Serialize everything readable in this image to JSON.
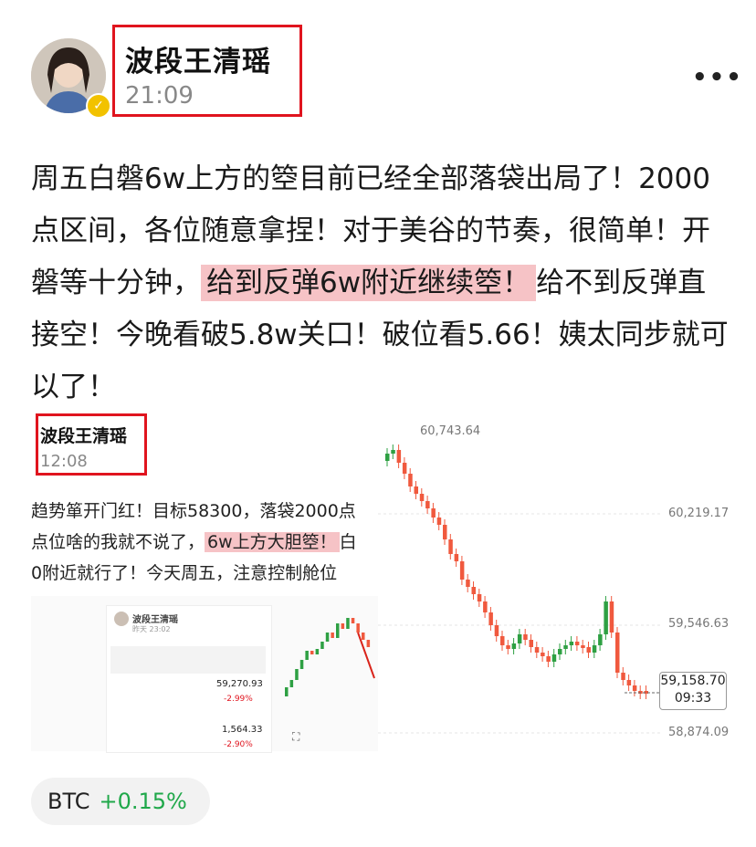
{
  "author": {
    "name": "波段王清瑶",
    "time": "21:09"
  },
  "post": {
    "text_before": "周五白磐6w上方的箜目前已经全部落袋出局了！2000点区间，各位随意拿捏！对于美谷的节奏，很简单！开磐等十分钟，",
    "highlight": "给到反弹6w附近继续箜！",
    "text_after": "给不到反弹直接空！今晚看破5.8w关口！破位看5.66！姨太同步就可以了！"
  },
  "quoted": {
    "name": "波段王清瑶",
    "time": "12:08",
    "line1": "趋势箪开门红！目标58300，落袋2000点",
    "line2_before": "点位啥的我就不说了，",
    "line2_highlight": "6w上方大胆箜！",
    "line2_after": "白",
    "line3": "0附近就行了！今天周五，注意控制舱位"
  },
  "mini": {
    "name": "波段王清瑶",
    "time": "昨天 23:02",
    "price1": "59,270.93",
    "pct1": "-2.99%",
    "price2": "1,564.33",
    "pct2": "-2.90%"
  },
  "chart_data": {
    "type": "candlestick",
    "price_labels": [
      "60,743.64",
      "60,219.17",
      "59,546.63",
      "58,874.09"
    ],
    "current_price": "59,158.70",
    "current_time": "09:33"
  },
  "ticker": {
    "symbol": "BTC",
    "change": "+0.15%"
  },
  "colors": {
    "up": "#2ea043",
    "down": "#f0593e",
    "highlight": "#f6c3c6",
    "frame": "#e0141e"
  },
  "icons": {
    "more": "more-dots-icon",
    "verified": "verified-badge-icon",
    "expand": "expand-icon"
  }
}
